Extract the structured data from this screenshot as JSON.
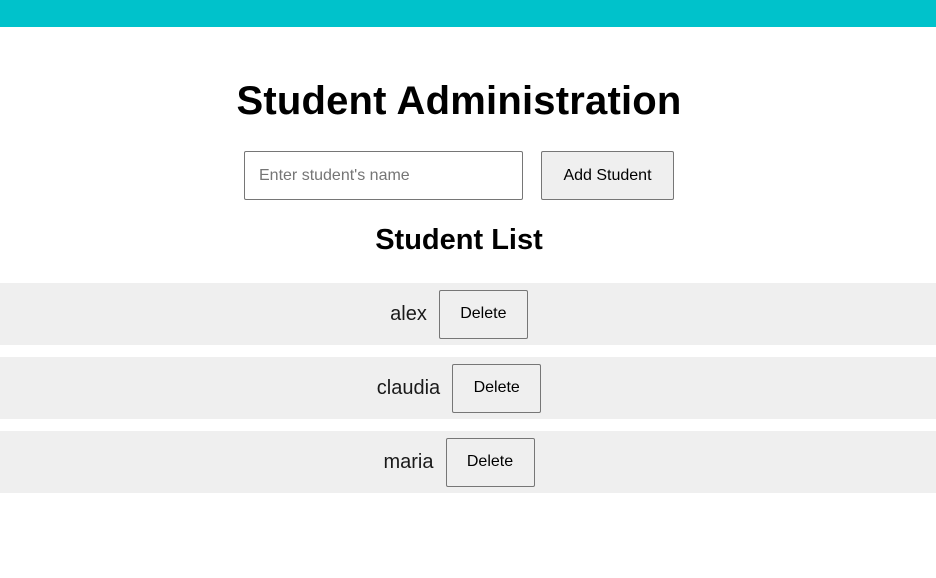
{
  "header": {
    "title": "Student Administration"
  },
  "form": {
    "input_value": "",
    "input_placeholder": "Enter student's name",
    "add_button_label": "Add Student"
  },
  "list": {
    "title": "Student List",
    "students": [
      {
        "name": "alex",
        "delete_label": "Delete"
      },
      {
        "name": "claudia",
        "delete_label": "Delete"
      },
      {
        "name": "maria",
        "delete_label": "Delete"
      }
    ]
  },
  "colors": {
    "top_bar": "#00c2cb",
    "row_background": "#efefef",
    "button_background": "#efefef"
  }
}
